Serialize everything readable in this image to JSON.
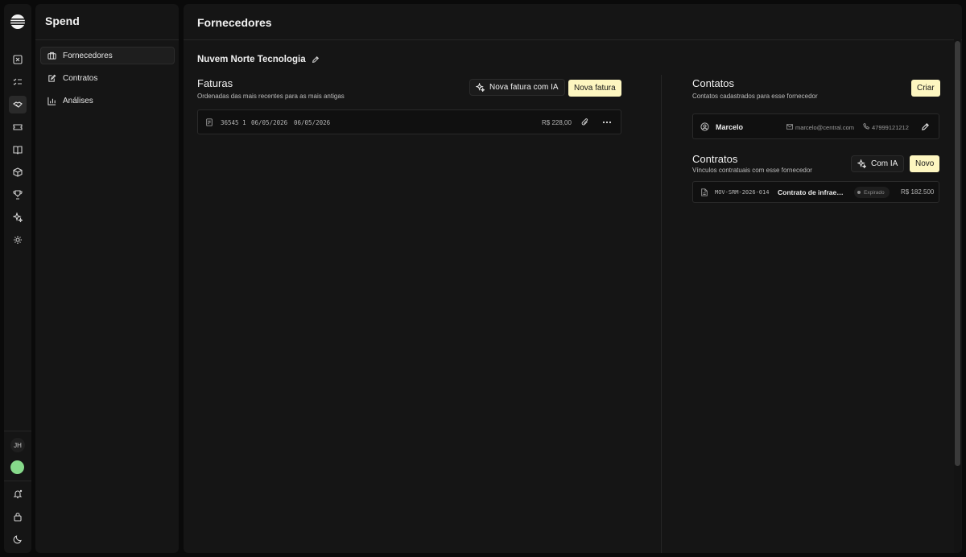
{
  "app": {
    "section_title": "Spend",
    "nav": [
      {
        "label": "Fornecedores",
        "icon": "building-icon",
        "active": true
      },
      {
        "label": "Contratos",
        "icon": "document-edit-icon",
        "active": false
      },
      {
        "label": "Análises",
        "icon": "bar-chart-icon",
        "active": false
      }
    ],
    "rail_icons": [
      "logo-icon",
      "x-square-icon",
      "checklist-icon",
      "handshake-icon",
      "ticket-icon",
      "book-icon",
      "package-icon",
      "trophy-icon",
      "sparkle-icon",
      "settings-icon"
    ],
    "user_initials": "JH",
    "status_color": "#86d98a"
  },
  "page": {
    "title": "Fornecedores",
    "supplier_name": "Nuvem Norte Tecnologia"
  },
  "invoices": {
    "title": "Faturas",
    "subtitle": "Ordenadas das mais recentes para as mais antigas",
    "ai_button": "Nova fatura com IA",
    "new_button": "Nova fatura",
    "rows": [
      {
        "number": "36545 1",
        "issue_date": "06/05/2026",
        "due_date": "06/05/2026",
        "amount": "R$ 228,00"
      }
    ]
  },
  "contacts": {
    "title": "Contatos",
    "subtitle": "Contatos cadastrados para esse fornecedor",
    "create_button": "Criar",
    "rows": [
      {
        "name": "Marcelo",
        "email": "marcelo@central.com",
        "phone": "47999121212"
      }
    ]
  },
  "contracts": {
    "title": "Contratos",
    "subtitle": "Vínculos contratuais com esse fornecedor",
    "ai_button": "Com IA",
    "new_button": "Novo",
    "rows": [
      {
        "code": "MOV-SRM-2026-014",
        "name": "Contrato de infrae…",
        "status": "Expirado",
        "amount": "R$ 182.500"
      }
    ]
  },
  "colors": {
    "accent_yellow": "#fdf6c0",
    "background": "#0a0a0a",
    "panel": "#151515"
  }
}
